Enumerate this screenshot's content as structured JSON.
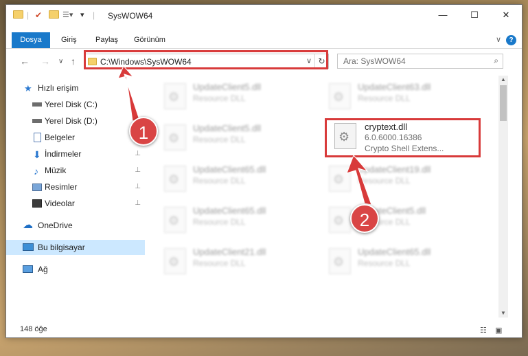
{
  "window": {
    "title": "SysWOW64",
    "controls": {
      "minimize": "—",
      "maximize": "☐",
      "close": "✕"
    }
  },
  "ribbon": {
    "tabs": [
      "Dosya",
      "Giriş",
      "Paylaş",
      "Görünüm"
    ],
    "help": "?",
    "collapse": "∨"
  },
  "nav": {
    "back": "←",
    "forward": "→",
    "recent": "∨",
    "up": "↑",
    "address": "C:\\Windows\\SysWOW64",
    "address_dropdown": "∨",
    "refresh": "↻",
    "search_placeholder": "Ara: SysWOW64"
  },
  "sidebar": {
    "items": [
      {
        "label": "Hızlı erişim",
        "icon": "star-icon"
      },
      {
        "label": "Yerel Disk (C:)",
        "icon": "drive-icon"
      },
      {
        "label": "Yerel Disk (D:)",
        "icon": "drive-icon"
      },
      {
        "label": "Belgeler",
        "icon": "documents-icon"
      },
      {
        "label": "İndirmeler",
        "icon": "download-icon"
      },
      {
        "label": "Müzik",
        "icon": "music-icon"
      },
      {
        "label": "Resimler",
        "icon": "pictures-icon"
      },
      {
        "label": "Videolar",
        "icon": "video-icon"
      },
      {
        "label": "OneDrive",
        "icon": "cloud-icon"
      },
      {
        "label": "Bu bilgisayar",
        "icon": "computer-icon"
      },
      {
        "label": "Ağ",
        "icon": "network-icon"
      }
    ],
    "pin": "📌"
  },
  "files": [
    {
      "name": "UpdateClient5.dll",
      "type": "Resource DLL"
    },
    {
      "name": "UpdateClient63.dll",
      "type": "Resource DLL"
    },
    {
      "name": "UpdateClient5.dll",
      "type": "Resource DLL"
    },
    {
      "name": "cryptext.dll",
      "version": "6.0.6000.16386",
      "description": "Crypto Shell Extens..."
    },
    {
      "name": "UpdateClient65.dll",
      "type": "Resource DLL"
    },
    {
      "name": "UpdateClient19.dll",
      "type": "Resource DLL"
    },
    {
      "name": "UpdateClient65.dll",
      "type": "Resource DLL"
    },
    {
      "name": "UpdateClient5.dll",
      "type": "Resource DLL"
    },
    {
      "name": "UpdateClient21.dll",
      "type": "Resource DLL"
    },
    {
      "name": "UpdateClient65.dll",
      "type": "Resource DLL"
    }
  ],
  "status": {
    "count": "148 öğe"
  },
  "annotations": {
    "step1": "1",
    "step2": "2",
    "color": "#d83a3a"
  }
}
